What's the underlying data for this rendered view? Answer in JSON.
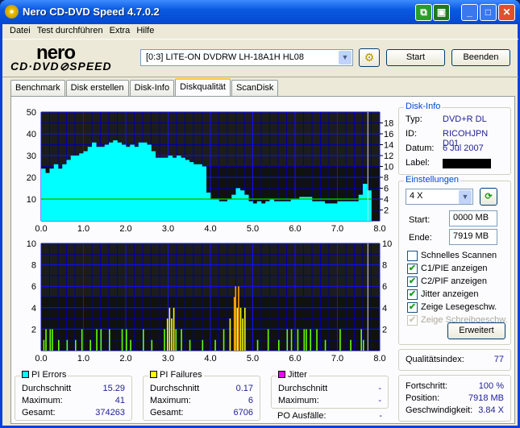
{
  "window": {
    "title": "Nero CD-DVD Speed 4.7.0.2"
  },
  "menu": [
    "Datei",
    "Test durchführen",
    "Extra",
    "Hilfe"
  ],
  "logo": {
    "line1": "nero",
    "line2": "CD·DVD⊘SPEED"
  },
  "toolbar": {
    "drive": "[0:3]   LITE-ON DVDRW LH-18A1H HL08",
    "start": "Start",
    "end": "Beenden"
  },
  "tabs": [
    "Benchmark",
    "Disk erstellen",
    "Disk-Info",
    "Diskqualität",
    "ScanDisk"
  ],
  "active_tab": 3,
  "disk_info": {
    "title": "Disk-Info",
    "typ_label": "Typ:",
    "typ": "DVD+R DL",
    "id_label": "ID:",
    "id": "RICOHJPN D01",
    "datum_label": "Datum:",
    "datum": "6 Jul 2007",
    "label_label": "Label:"
  },
  "settings": {
    "title": "Einstellungen",
    "speed": "4 X",
    "start_label": "Start:",
    "start": "0000 MB",
    "end_label": "Ende:",
    "end": "7919 MB",
    "checks": [
      {
        "label": "Schnelles Scannen",
        "checked": false,
        "disabled": false
      },
      {
        "label": "C1/PIE anzeigen",
        "checked": true,
        "disabled": false
      },
      {
        "label": "C2/PIF anzeigen",
        "checked": true,
        "disabled": false
      },
      {
        "label": "Jitter anzeigen",
        "checked": true,
        "disabled": false
      },
      {
        "label": "Zeige Lesegeschw.",
        "checked": true,
        "disabled": false
      },
      {
        "label": "Zeige Schreibgeschw.",
        "checked": true,
        "disabled": true
      }
    ],
    "advanced": "Erweitert"
  },
  "quality": {
    "label": "Qualitätsindex:",
    "value": "77"
  },
  "progress": {
    "fortschritt_label": "Fortschritt:",
    "fortschritt": "100 %",
    "position_label": "Position:",
    "position": "7918 MB",
    "speed_label": "Geschwindigkeit:",
    "speed": "3.84 X"
  },
  "stats": {
    "pie": {
      "title": "PI Errors",
      "color": "#00ffff",
      "avg_label": "Durchschnitt",
      "avg": "15.29",
      "max_label": "Maximum:",
      "max": "41",
      "total_label": "Gesamt:",
      "total": "374263"
    },
    "pif": {
      "title": "PI Failures",
      "color": "#ffff00",
      "avg_label": "Durchschnitt",
      "avg": "0.17",
      "max_label": "Maximum:",
      "max": "6",
      "total_label": "Gesamt:",
      "total": "6706"
    },
    "jitter": {
      "title": "Jitter",
      "color": "#ff00ff",
      "avg_label": "Durchschnitt",
      "avg": "-",
      "max_label": "Maximum:",
      "max": "-",
      "po_label": "PO Ausfälle:",
      "po": "-"
    }
  },
  "chart_data": [
    {
      "type": "area",
      "title": "PI Errors",
      "xlim": [
        0,
        8
      ],
      "ylim": [
        0,
        50
      ],
      "y2lim": [
        0,
        20
      ],
      "xticks": [
        "0.0",
        "1.0",
        "2.0",
        "3.0",
        "4.0",
        "5.0",
        "6.0",
        "7.0",
        "8.0"
      ],
      "yticks": [
        "10",
        "20",
        "30",
        "40",
        "50"
      ],
      "y2ticks": [
        "2",
        "4",
        "6",
        "8",
        "10",
        "12",
        "14",
        "16",
        "18"
      ],
      "x_step": 0.1,
      "values": [
        24,
        22,
        24,
        26,
        24,
        26,
        28,
        30,
        30,
        31,
        32,
        34,
        36,
        34,
        34,
        35,
        36,
        37,
        36,
        35,
        34,
        35,
        34,
        36,
        36,
        35,
        32,
        29,
        29,
        29,
        30,
        29,
        30,
        29,
        28,
        27,
        26,
        26,
        25,
        13,
        10,
        10,
        9,
        9,
        10,
        12,
        15,
        14,
        12,
        9,
        8,
        9,
        8,
        9,
        10,
        9,
        9,
        9,
        9,
        10,
        10,
        11,
        11,
        11,
        9,
        9,
        9,
        8,
        8,
        8,
        9,
        9,
        9,
        9,
        9,
        12,
        17,
        14
      ],
      "read_speed": 4.0
    },
    {
      "type": "bar",
      "title": "PI Failures",
      "xlim": [
        0,
        8
      ],
      "ylim": [
        0,
        10
      ],
      "xticks": [
        "0.0",
        "1.0",
        "2.0",
        "3.0",
        "4.0",
        "5.0",
        "6.0",
        "7.0",
        "8.0"
      ],
      "yticks": [
        "2",
        "4",
        "6",
        "8",
        "10"
      ],
      "points": [
        [
          0.05,
          1
        ],
        [
          0.1,
          2
        ],
        [
          0.2,
          2
        ],
        [
          0.25,
          2
        ],
        [
          0.4,
          1
        ],
        [
          0.6,
          1
        ],
        [
          0.8,
          1
        ],
        [
          0.95,
          2
        ],
        [
          1.15,
          1
        ],
        [
          1.3,
          2
        ],
        [
          1.4,
          2
        ],
        [
          1.6,
          2
        ],
        [
          1.9,
          2
        ],
        [
          2.0,
          2
        ],
        [
          2.1,
          1
        ],
        [
          2.4,
          2
        ],
        [
          2.6,
          1
        ],
        [
          2.9,
          2
        ],
        [
          2.97,
          3
        ],
        [
          3.02,
          4
        ],
        [
          3.07,
          3
        ],
        [
          3.12,
          4
        ],
        [
          3.17,
          2
        ],
        [
          3.3,
          2
        ],
        [
          3.5,
          1
        ],
        [
          3.8,
          1
        ],
        [
          4.1,
          1
        ],
        [
          4.3,
          2
        ],
        [
          4.45,
          3
        ],
        [
          4.55,
          5
        ],
        [
          4.58,
          6
        ],
        [
          4.62,
          4
        ],
        [
          4.65,
          6
        ],
        [
          4.7,
          4
        ],
        [
          4.75,
          3
        ],
        [
          4.8,
          4
        ],
        [
          5.1,
          1
        ],
        [
          5.35,
          2
        ],
        [
          5.6,
          1
        ],
        [
          5.8,
          2
        ],
        [
          5.9,
          2
        ],
        [
          6.05,
          2
        ],
        [
          6.2,
          2
        ],
        [
          6.25,
          2
        ],
        [
          6.35,
          2
        ],
        [
          6.5,
          2
        ],
        [
          6.7,
          1
        ],
        [
          7.05,
          2
        ],
        [
          7.3,
          1
        ],
        [
          7.55,
          2
        ],
        [
          7.6,
          1
        ]
      ]
    }
  ]
}
